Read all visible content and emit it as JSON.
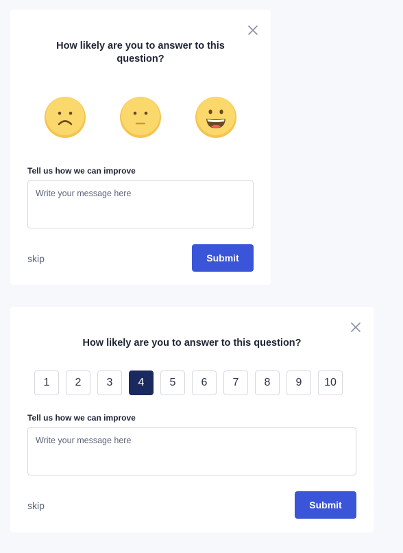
{
  "colors": {
    "page_background": "#f7f8fc",
    "card_background": "#ffffff",
    "primary_button": "#3a55d8",
    "selected_scale": "#1b2a5e",
    "emoji_face": "#fbd86b"
  },
  "emoji_survey": {
    "question": "How likely are you to answer to this question?",
    "emojis": [
      {
        "icon": "sad-face-icon"
      },
      {
        "icon": "neutral-face-icon"
      },
      {
        "icon": "happy-face-icon"
      }
    ],
    "improve_label": "Tell us how we can improve",
    "message_placeholder": "Write your message here",
    "skip_label": "skip",
    "submit_label": "Submit"
  },
  "numeric_survey": {
    "question": "How likely are you to answer to this question?",
    "scale": [
      "1",
      "2",
      "3",
      "4",
      "5",
      "6",
      "7",
      "8",
      "9",
      "10"
    ],
    "selected_value": "4",
    "improve_label": "Tell us how we can improve",
    "message_placeholder": "Write your message here",
    "skip_label": "skip",
    "submit_label": "Submit"
  }
}
